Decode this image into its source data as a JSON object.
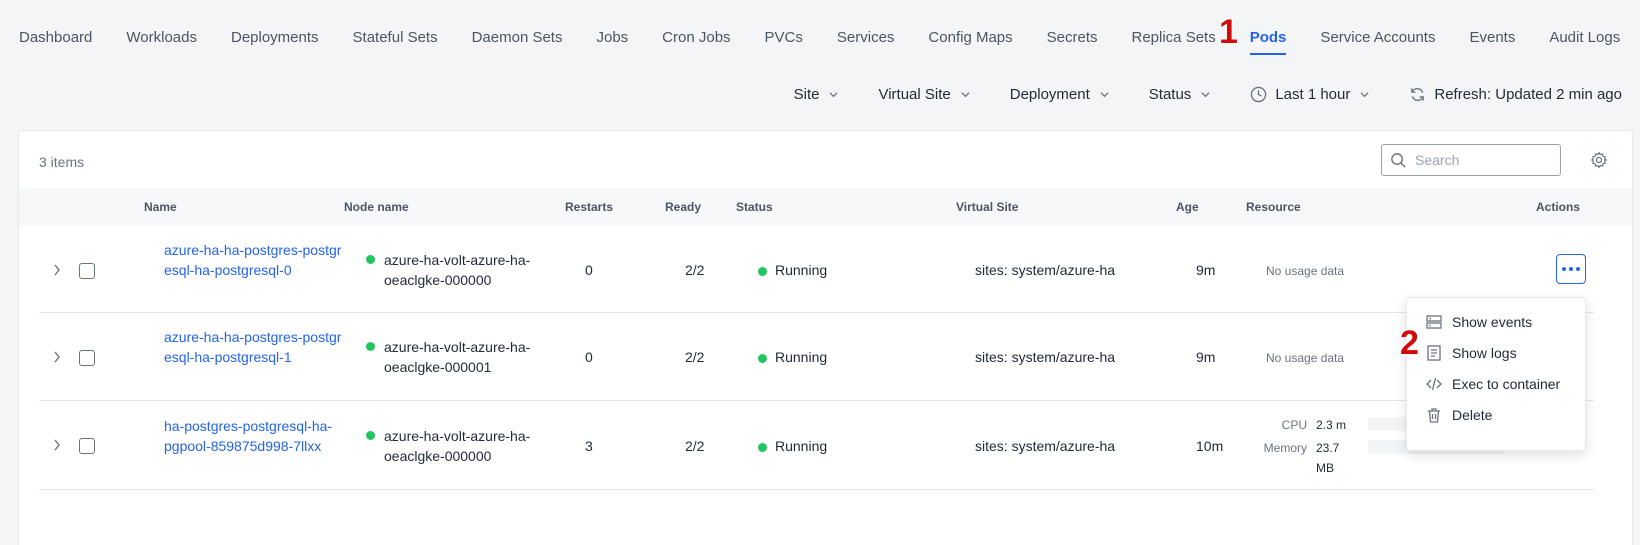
{
  "nav": {
    "tabs": [
      {
        "label": "Dashboard"
      },
      {
        "label": "Workloads"
      },
      {
        "label": "Deployments"
      },
      {
        "label": "Stateful Sets"
      },
      {
        "label": "Daemon Sets"
      },
      {
        "label": "Jobs"
      },
      {
        "label": "Cron Jobs"
      },
      {
        "label": "PVCs"
      },
      {
        "label": "Services"
      },
      {
        "label": "Config Maps"
      },
      {
        "label": "Secrets"
      },
      {
        "label": "Replica Sets"
      },
      {
        "label": "Pods"
      },
      {
        "label": "Service Accounts"
      },
      {
        "label": "Events"
      },
      {
        "label": "Audit Logs"
      }
    ],
    "active_tab": "Pods"
  },
  "filters": {
    "site": "Site",
    "virtual_site": "Virtual Site",
    "deployment": "Deployment",
    "status": "Status",
    "time_range": "Last 1 hour",
    "refresh": "Refresh: Updated 2 min ago"
  },
  "table": {
    "items_count": "3 items",
    "search_placeholder": "Search",
    "columns": {
      "name": "Name",
      "node_name": "Node name",
      "restarts": "Restarts",
      "ready": "Ready",
      "status": "Status",
      "virtual_site": "Virtual Site",
      "age": "Age",
      "resource": "Resource",
      "actions": "Actions"
    },
    "rows": [
      {
        "name": "azure-ha-ha-postgres-postgresql-ha-postgresql-0",
        "node": "azure-ha-volt-azure-ha-oeaclgke-000000",
        "restarts": "0",
        "ready": "2/2",
        "status": "Running",
        "virtual_site": "sites: system/azure-ha",
        "age": "9m",
        "resource": "No usage data"
      },
      {
        "name": "azure-ha-ha-postgres-postgresql-ha-postgresql-1",
        "node": "azure-ha-volt-azure-ha-oeaclgke-000001",
        "restarts": "0",
        "ready": "2/2",
        "status": "Running",
        "virtual_site": "sites: system/azure-ha",
        "age": "9m",
        "resource": "No usage data"
      },
      {
        "name": "ha-postgres-postgresql-ha-pgpool-859875d998-7llxx",
        "node": "azure-ha-volt-azure-ha-oeaclgke-000000",
        "restarts": "3",
        "ready": "2/2",
        "status": "Running",
        "virtual_site": "sites: system/azure-ha",
        "age": "10m",
        "cpu_label": "CPU",
        "cpu_value": "2.3 m",
        "memory_label": "Memory",
        "memory_value": "23.7 MB"
      }
    ]
  },
  "actions_menu": {
    "items": [
      {
        "label": "Show events",
        "icon": "server-icon"
      },
      {
        "label": "Show logs",
        "icon": "logs-icon"
      },
      {
        "label": "Exec to container",
        "icon": "code-icon"
      },
      {
        "label": "Delete",
        "icon": "trash-icon"
      }
    ]
  },
  "annotations": {
    "step1": "1",
    "step2": "2"
  },
  "colors": {
    "accent": "#2563eb",
    "running": "#22c55e",
    "annotation": "#d10a0a"
  }
}
